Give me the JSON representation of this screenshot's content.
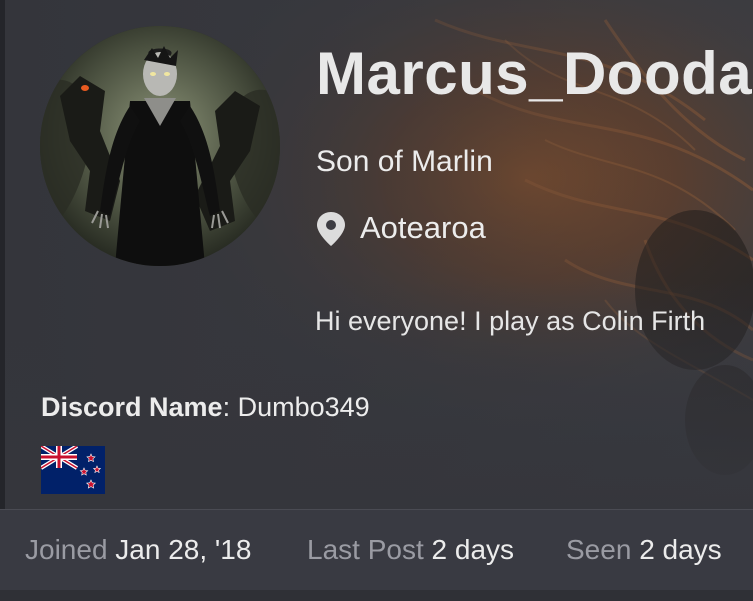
{
  "profile": {
    "username": "Marcus_Doodal",
    "user_title": "Son of Marlin",
    "location": "Aotearoa",
    "bio": "Hi everyone! I play as Colin Firth",
    "discord_label": "Discord Name",
    "discord_separator": ":",
    "discord_value": " Dumbo349"
  },
  "icons": {
    "location": "map-pin-icon",
    "flag": "new-zealand-flag-icon"
  },
  "stats": {
    "joined_label": "Joined",
    "joined_value": "Jan 28, '18",
    "last_post_label": "Last Post",
    "last_post_value": "2 days",
    "seen_label": "Seen",
    "seen_value": "2 days"
  },
  "colors": {
    "background": "#2f3036",
    "stats_bar": "#393a42",
    "text": "#ececec",
    "muted_text": "#9a9ba3",
    "banner_accent": "#9c5a2c"
  }
}
